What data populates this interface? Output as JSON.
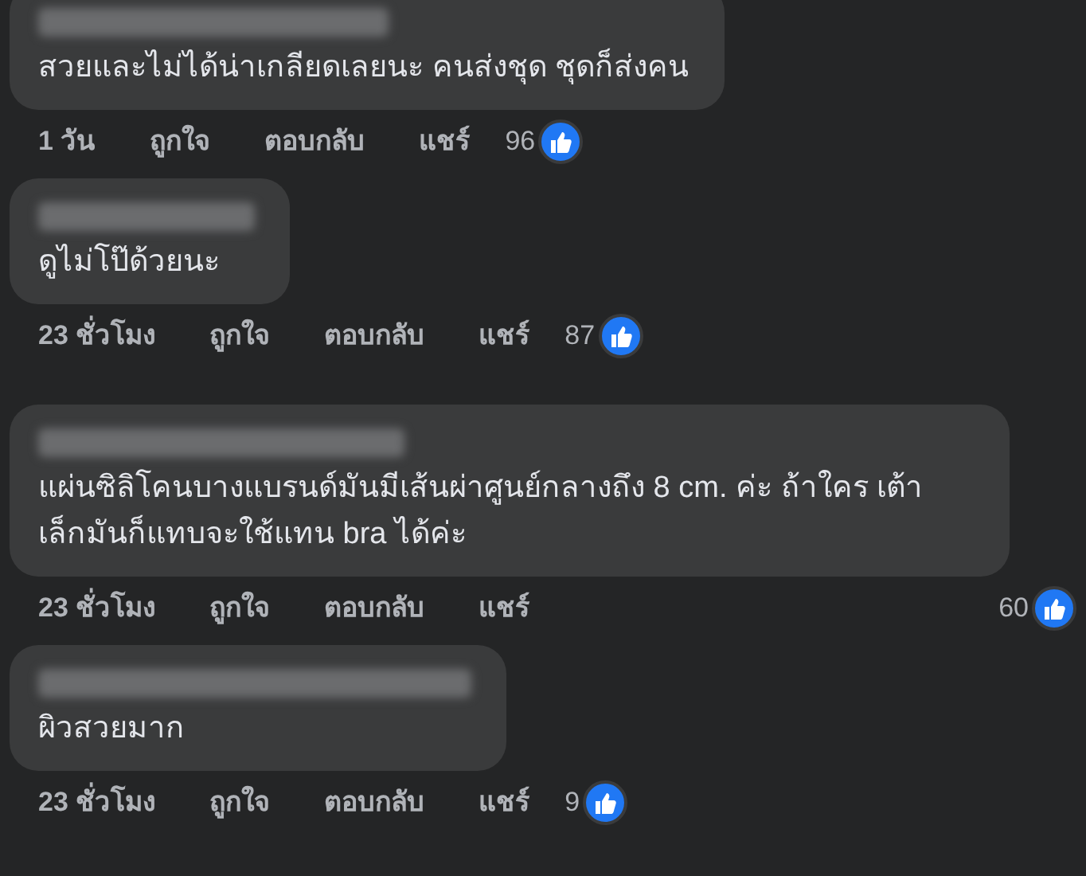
{
  "comments": [
    {
      "text": "สวยและไม่ได้น่าเกลียดเลยนะ คนส่งชุด ชุดก็ส่งคน",
      "time": "1 วัน",
      "actions": [
        "ถูกใจ",
        "ตอบกลับ",
        "แชร์"
      ],
      "reactions": "96"
    },
    {
      "text": "ดูไม่โป๊ด้วยนะ",
      "time": "23 ชั่วโมง",
      "actions": [
        "ถูกใจ",
        "ตอบกลับ",
        "แชร์"
      ],
      "reactions": "87"
    },
    {
      "text": "แผ่นซิลิโคนบางแบรนด์มันมีเส้นผ่าศูนย์กลางถึง 8 cm. ค่ะ ถ้าใคร เต้าเล็กมันก็แทบจะใช้แทน bra ได้ค่ะ",
      "time": "23 ชั่วโมง",
      "actions": [
        "ถูกใจ",
        "ตอบกลับ",
        "แชร์"
      ],
      "reactions": "60"
    },
    {
      "text": "ผิวสวยมาก",
      "time": "23 ชั่วโมง",
      "actions": [
        "ถูกใจ",
        "ตอบกลับ",
        "แชร์"
      ],
      "reactions": "9"
    }
  ]
}
